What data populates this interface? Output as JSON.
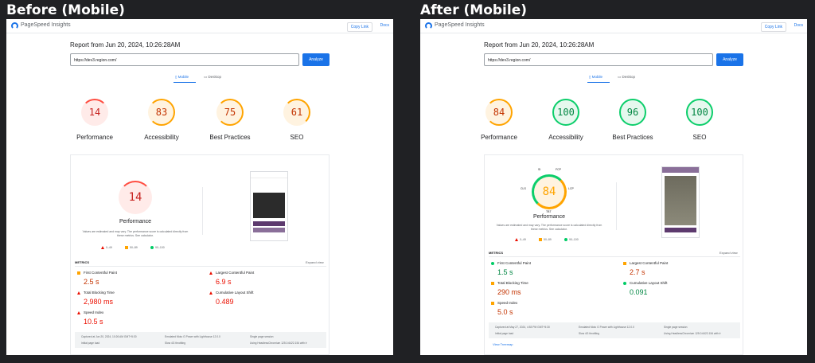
{
  "before": {
    "heading": "Before (Mobile)",
    "app_title": "PageSpeed Insights",
    "copy_link": "Copy Link",
    "docs": "Docs",
    "report": "Report from Jun 20, 2024, 10:26:28AM",
    "url": "https://dev3.region.com/",
    "analyze": "Analyze",
    "tab_mobile": "Mobile",
    "tab_desktop": "Desktop",
    "gauges": [
      {
        "score": "14",
        "label": "Performance"
      },
      {
        "score": "83",
        "label": "Accessibility"
      },
      {
        "score": "75",
        "label": "Best Practices"
      },
      {
        "score": "61",
        "label": "SEO"
      }
    ],
    "perf_score": "14",
    "perf_label": "Performance",
    "note": "Values are estimated and may vary. The performance score is calculated directly from these metrics. See calculator.",
    "legend": [
      "0–49",
      "50–89",
      "90–100"
    ],
    "metrics_title": "METRICS",
    "expand": "Expand view",
    "metrics": [
      {
        "label": "First Contentful Paint",
        "value": "2.5 s"
      },
      {
        "label": "Largest Contentful Paint",
        "value": "6.9 s"
      },
      {
        "label": "Total Blocking Time",
        "value": "2,980 ms"
      },
      {
        "label": "Cumulative Layout Shift",
        "value": "0.489"
      },
      {
        "label": "Speed Index",
        "value": "10.5 s"
      }
    ],
    "footer": [
      "Captured at Jun 20, 2024, 10:26 AM GMT+5:30",
      "Emulated Moto G Power with Lighthouse 12.0.0",
      "Single page session",
      "Initial page load",
      "Slow 4G throttling",
      "Using HeadlessChromium 125.0.6422.154 with lr"
    ]
  },
  "after": {
    "heading": "After (Mobile)",
    "app_title": "PageSpeed Insights",
    "copy_link": "Copy Link",
    "docs": "Docs",
    "report": "Report from Jun 20, 2024, 10:26:28AM",
    "url": "https://dev3.region.com/",
    "analyze": "Analyze",
    "tab_mobile": "Mobile",
    "tab_desktop": "Desktop",
    "gauges": [
      {
        "score": "84",
        "label": "Performance"
      },
      {
        "score": "100",
        "label": "Accessibility"
      },
      {
        "score": "96",
        "label": "Best Practices"
      },
      {
        "score": "100",
        "label": "SEO"
      }
    ],
    "perf_score": "84",
    "perf_label": "Performance",
    "segments": {
      "si": "SI",
      "fcp": "FCP",
      "cls": "CLS",
      "lcp": "LCP",
      "tbt": "TBT"
    },
    "note": "Values are estimated and may vary. The performance score is calculated directly from these metrics. See calculator.",
    "legend": [
      "0–49",
      "50–89",
      "90–100"
    ],
    "metrics_title": "METRICS",
    "expand": "Expand view",
    "metrics": [
      {
        "label": "First Contentful Paint",
        "value": "1.5 s"
      },
      {
        "label": "Largest Contentful Paint",
        "value": "2.7 s"
      },
      {
        "label": "Total Blocking Time",
        "value": "290 ms"
      },
      {
        "label": "Cumulative Layout Shift",
        "value": "0.091"
      },
      {
        "label": "Speed Index",
        "value": "5.0 s"
      }
    ],
    "footer": [
      "Captured at May 27, 2024, 4:53 PM GMT+5:30",
      "Emulated Moto G Power with Lighthouse 12.0.0",
      "Single page session",
      "Initial page load",
      "Slow 4G throttling",
      "Using HeadlessChromium 125.0.6422.154 with lr"
    ],
    "view_treemap": "View Treemap"
  },
  "colors": {
    "red": "#ff4e42",
    "orange": "#ffa400",
    "green": "#0cce6b"
  }
}
